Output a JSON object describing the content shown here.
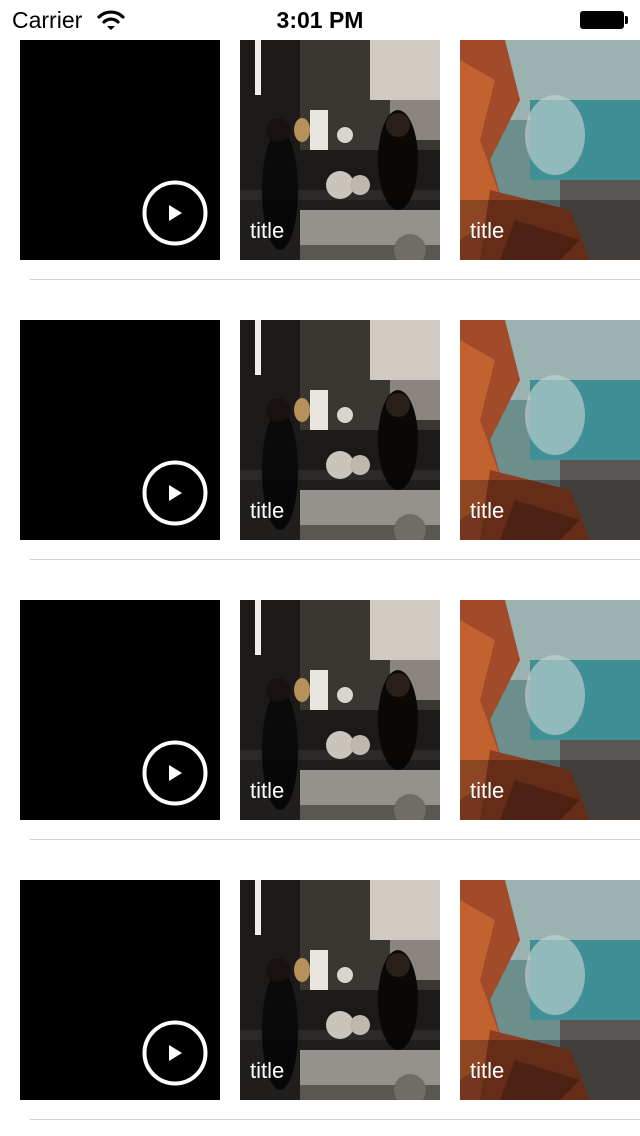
{
  "status_bar": {
    "carrier": "Carrier",
    "time": "3:01 PM",
    "wifi_icon": "wifi-icon",
    "battery_icon": "battery-icon"
  },
  "rows": [
    {
      "video": {
        "icon": "play-icon"
      },
      "photo_bar": {
        "title": "title"
      },
      "photo_coast": {
        "title": "title"
      }
    },
    {
      "video": {
        "icon": "play-icon"
      },
      "photo_bar": {
        "title": "title"
      },
      "photo_coast": {
        "title": "title"
      }
    },
    {
      "video": {
        "icon": "play-icon"
      },
      "photo_bar": {
        "title": "title"
      },
      "photo_coast": {
        "title": "title"
      }
    },
    {
      "video": {
        "icon": "play-icon"
      },
      "photo_bar": {
        "title": "title"
      },
      "photo_coast": {
        "title": "title"
      }
    }
  ],
  "colors": {
    "separator": "#d2d2d6",
    "video_background": "#000000",
    "title_text": "#ffffff"
  }
}
